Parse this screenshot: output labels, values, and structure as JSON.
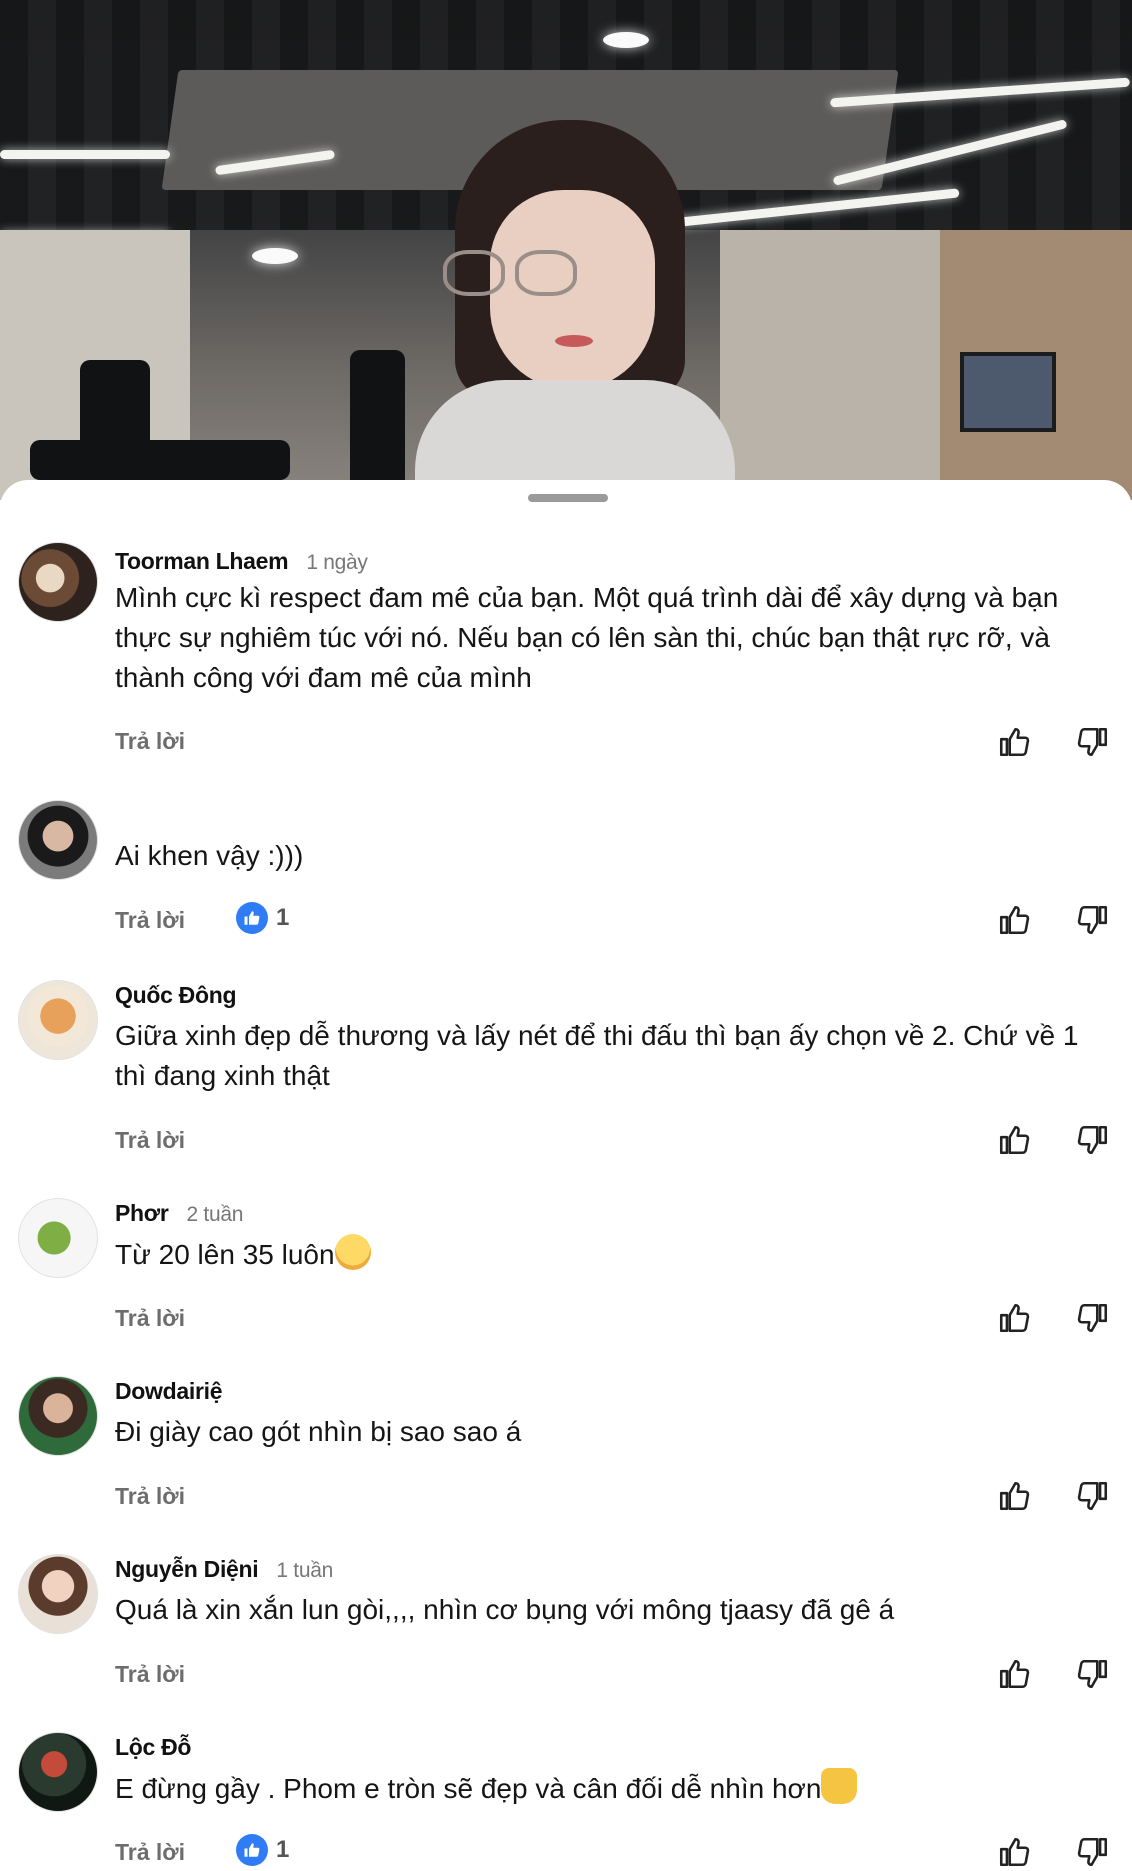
{
  "video": {
    "description_icon": "video-frame"
  },
  "sheet": {
    "handle": "drag-handle"
  },
  "reply_label": "Trả lời",
  "comments": [
    {
      "username": "Toorman Lhaem",
      "meta": "1 ngày",
      "text": "Mình cực kì respect đam mê của bạn. Một quá trình dài để xây dựng và bạn thực sự nghiêm túc với nó. Nếu bạn có lên sàn thi, chúc bạn thật rực rỡ, và thành công với đam mê của mình",
      "likes": ""
    },
    {
      "username": "",
      "meta": "",
      "text": "Ai khen vậy :)))",
      "likes": "1"
    },
    {
      "username": "Quốc Đông",
      "meta": "",
      "text": "Giữa xinh đẹp dễ thương và lấy nét để thi đấu thì bạn ấy chọn về 2. Chứ về 1 thì đang xinh thật",
      "likes": ""
    },
    {
      "username": "Phơr",
      "meta": "2 tuần",
      "text": "Từ 20 lên 35 luôn",
      "likes": ""
    },
    {
      "username": "Dowdairiệ",
      "meta": "",
      "text": "Đi giày cao gót nhìn bị sao sao á",
      "likes": ""
    },
    {
      "username": "Nguyễn Diệni",
      "meta": "1 tuần",
      "text": "Quá là xin xắn lun gòi,,,, nhìn cơ bụng với mông tjaasy đã gê á",
      "likes": ""
    },
    {
      "username": "Lộc Đỗ",
      "meta": "",
      "text": "E đừng gầy . Phom e tròn sẽ đẹp và cân đối dễ nhìn hơn",
      "likes": "1"
    }
  ]
}
